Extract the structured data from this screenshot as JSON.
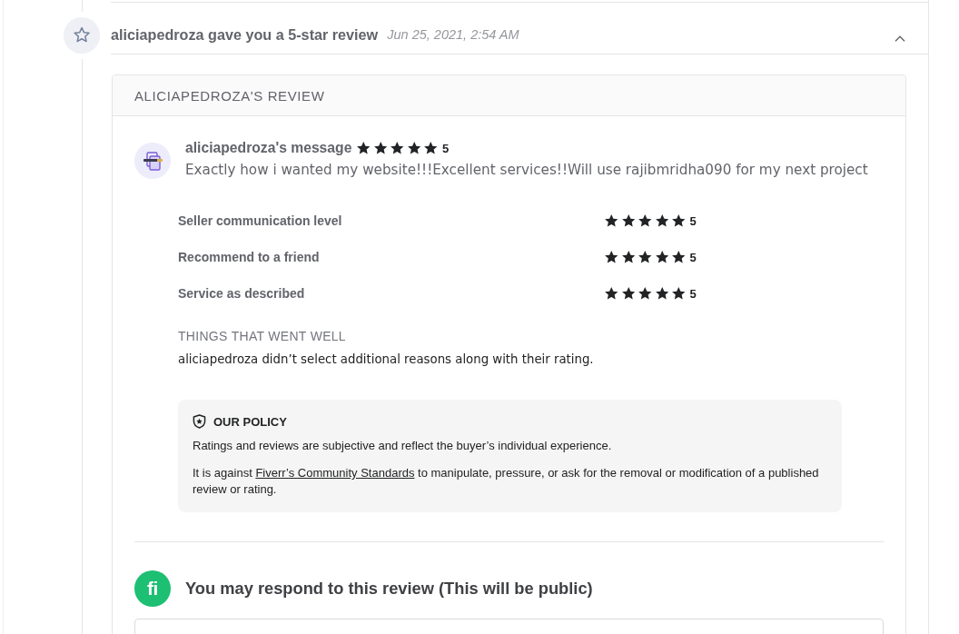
{
  "activity": {
    "title": "aliciapedroza gave you a 5-star review",
    "time": "Jun 25, 2021, 2:54 AM",
    "expanded": true
  },
  "review": {
    "heading": "ALICIAPEDROZA'S REVIEW",
    "message": {
      "author": "aliciapedroza's message",
      "stars": 5,
      "reading": "5",
      "text": "Exactly how i wanted my website!!!Excellent services!!Will use rajibmridha090 for my next project"
    },
    "ratings": [
      {
        "label": "Seller communication level",
        "stars": 5,
        "reading": "5"
      },
      {
        "label": "Recommend to a friend",
        "stars": 5,
        "reading": "5"
      },
      {
        "label": "Service as described",
        "stars": 5,
        "reading": "5"
      }
    ],
    "things_heading": "THINGS THAT WENT WELL",
    "things_text": "aliciapedroza didn’t select additional reasons along with their rating.",
    "policy": {
      "title": "OUR POLICY",
      "paragraphs": [
        {
          "before": "Ratings and reviews are subjective and reflect the buyer’s individual experience."
        },
        {
          "before": "It is against ",
          "link": "Fiverr’s Community Standards",
          "after": " to manipulate, pressure, or ask for the removal or modification of a published review or rating."
        }
      ]
    }
  },
  "respond": {
    "logo": "fi",
    "title": "You may respond to this review (This will be public)"
  }
}
